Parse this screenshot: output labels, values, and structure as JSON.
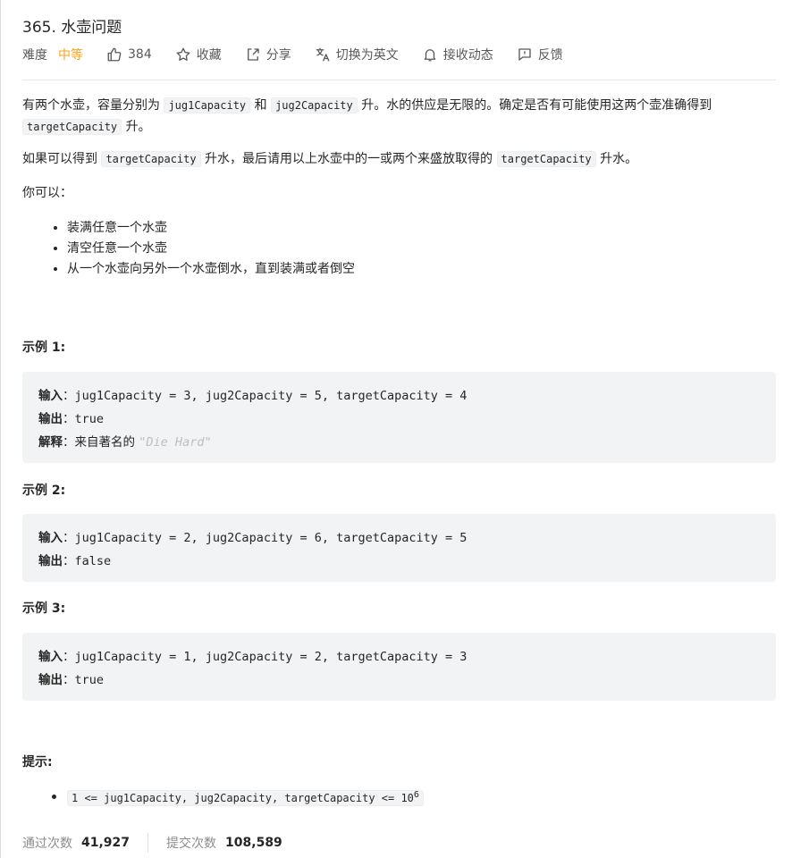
{
  "problem": {
    "title": "365. 水壶问题"
  },
  "meta": {
    "difficulty_label": "难度",
    "difficulty_value": "中等",
    "likes": "384",
    "favorite": "收藏",
    "share": "分享",
    "switch_lang": "切换为英文",
    "notifications": "接收动态",
    "feedback": "反馈"
  },
  "description": {
    "p1_a": "有两个水壶，容量分别为 ",
    "p1_code1": "jug1Capacity",
    "p1_b": " 和 ",
    "p1_code2": "jug2Capacity",
    "p1_c": " 升。水的供应是无限的。确定是否有可能使用这两个壶准确得到 ",
    "p1_code3": "targetCapacity",
    "p1_d": " 升。",
    "p2_a": "如果可以得到 ",
    "p2_code1": "targetCapacity",
    "p2_b": " 升水，最后请用以上水壶中的一或两个来盛放取得的 ",
    "p2_code2": "targetCapacity",
    "p2_c": " 升水。",
    "p3": "你可以：",
    "bullets": [
      "装满任意一个水壶",
      "清空任意一个水壶",
      "从一个水壶向另外一个水壶倒水，直到装满或者倒空"
    ]
  },
  "examples": [
    {
      "title": "示例 1:",
      "input_label": "输入",
      "input": "：jug1Capacity = 3, jug2Capacity = 5, targetCapacity = 4",
      "output_label": "输出",
      "output": "：true",
      "explain_label": "解释",
      "explain": "：来自著名的 ",
      "explain_quote": "\"Die Hard\""
    },
    {
      "title": "示例 2:",
      "input_label": "输入",
      "input": "：jug1Capacity = 2, jug2Capacity = 6, targetCapacity = 5",
      "output_label": "输出",
      "output": "：false"
    },
    {
      "title": "示例 3:",
      "input_label": "输入",
      "input": "：jug1Capacity = 1, jug2Capacity = 2, targetCapacity = 3",
      "output_label": "输出",
      "output": "：true"
    }
  ],
  "hints": {
    "title": "提示:",
    "constraint": "1 <= jug1Capacity, jug2Capacity, targetCapacity <= 10",
    "constraint_sup": "6"
  },
  "stats": {
    "accepted_label": "通过次数",
    "accepted_value": "41,927",
    "submissions_label": "提交次数",
    "submissions_value": "108,589"
  },
  "colors": {
    "difficulty_medium": "#ffa116",
    "code_bg": "#f2f3f4",
    "muted_text": "#8c8c8c"
  },
  "icons": [
    "thumbs-up-icon",
    "star-icon",
    "share-icon",
    "translate-icon",
    "bell-icon",
    "feedback-icon"
  ]
}
